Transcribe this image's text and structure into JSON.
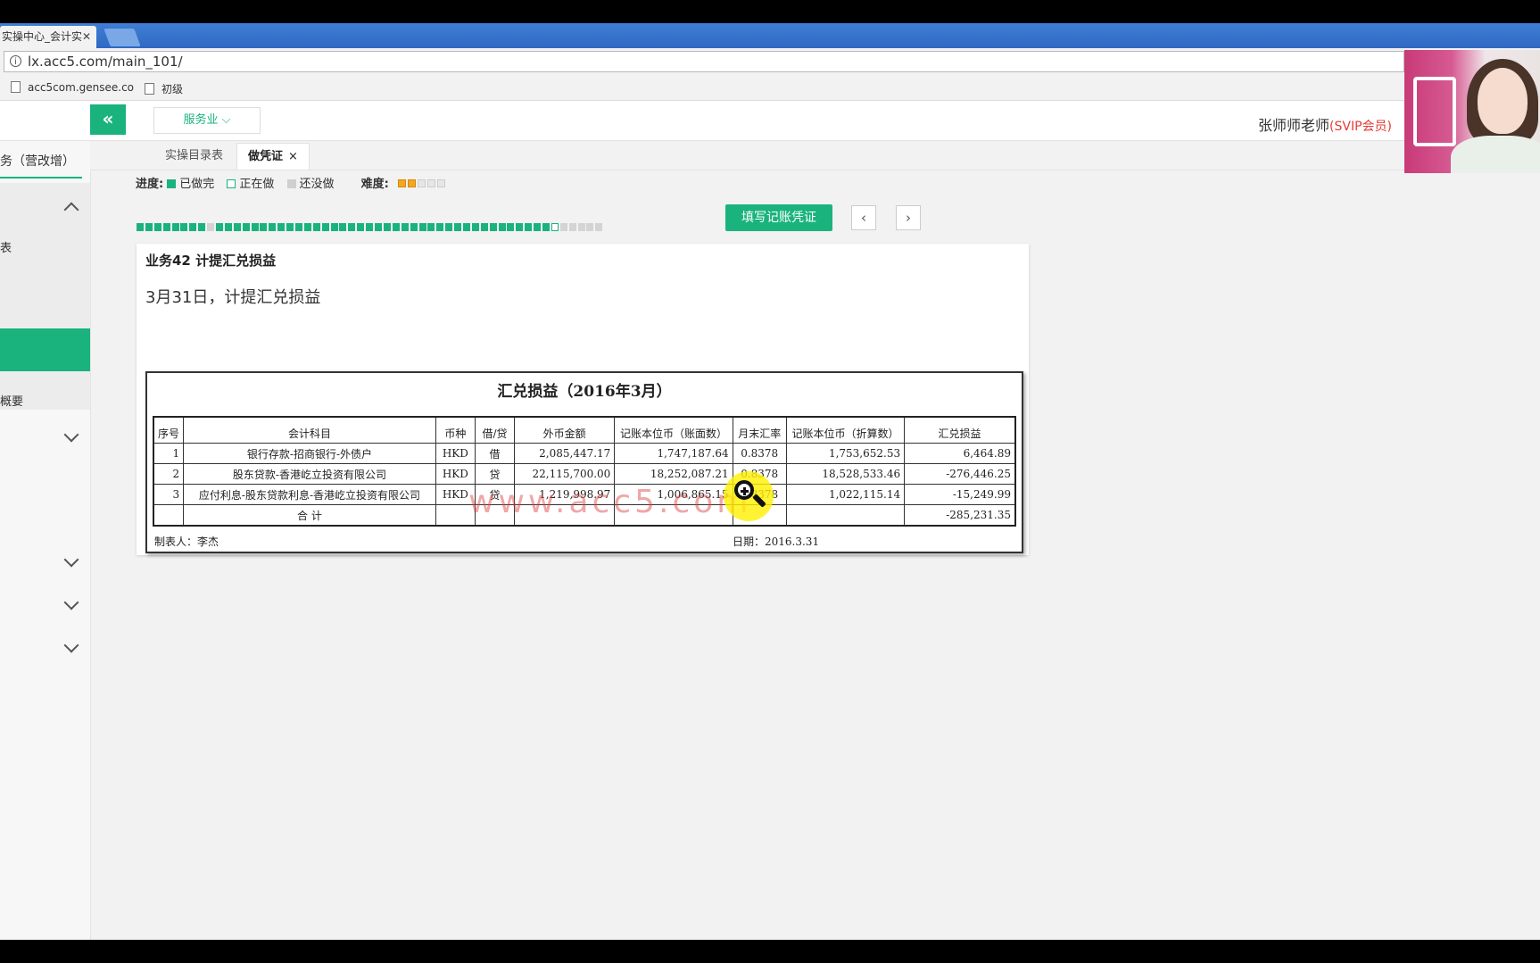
{
  "browser": {
    "tab_title": "实操中心_会计实",
    "tab_close": "✕",
    "url": "lx.acc5.com/main_101/",
    "bookmarks": [
      "acc5com.gensee.co",
      "初级"
    ]
  },
  "header": {
    "collapse_icon": "«",
    "industry": "服务业 ⌵",
    "teacher_name": "张师师老师",
    "teacher_badge": "(SVIP会员)"
  },
  "sidebar": {
    "title": "务（营改增）",
    "items": [
      "表",
      "概要"
    ]
  },
  "page_tabs": [
    {
      "label": "实操目录表"
    },
    {
      "label": "做凭证",
      "close": "×"
    }
  ],
  "progress": {
    "label": "进度:",
    "done": "已做完",
    "doing": "正在做",
    "todo": "还没做",
    "difficulty_label": "难度:",
    "difficulty_stars": 2,
    "difficulty_max": 5,
    "total_tasks": 53,
    "done_tasks": 47,
    "current_task": 48
  },
  "actions": {
    "fill_voucher": "填写记账凭证",
    "prev": "‹",
    "next": "›"
  },
  "task": {
    "title": "业务42 计提汇兑损益",
    "description": "3月31日，计提汇兑损益"
  },
  "report": {
    "title": "汇兑损益（2016年3月）",
    "headers": [
      "序号",
      "会计科目",
      "币种",
      "借/贷",
      "外币金额",
      "记账本位币（账面数）",
      "月末汇率",
      "记账本位币（折算数）",
      "汇兑损益"
    ],
    "rows": [
      [
        "1",
        "银行存款-招商银行-外债户",
        "HKD",
        "借",
        "2,085,447.17",
        "1,747,187.64",
        "0.8378",
        "1,753,652.53",
        "6,464.89"
      ],
      [
        "2",
        "股东贷款-香港屹立投资有限公司",
        "HKD",
        "贷",
        "22,115,700.00",
        "18,252,087.21",
        "0.8378",
        "18,528,533.46",
        "-276,446.25"
      ],
      [
        "3",
        "应付利息-股东贷款利息-香港屹立投资有限公司",
        "HKD",
        "贷",
        "1,219,998.97",
        "1,006,865.15",
        "0.8378",
        "1,022,115.14",
        "-15,249.99"
      ]
    ],
    "total_label": "合    计",
    "total_value": "-285,231.35",
    "preparer": "制表人：李杰",
    "date": "日期：2016.3.31",
    "watermark": "www.acc5.com"
  }
}
